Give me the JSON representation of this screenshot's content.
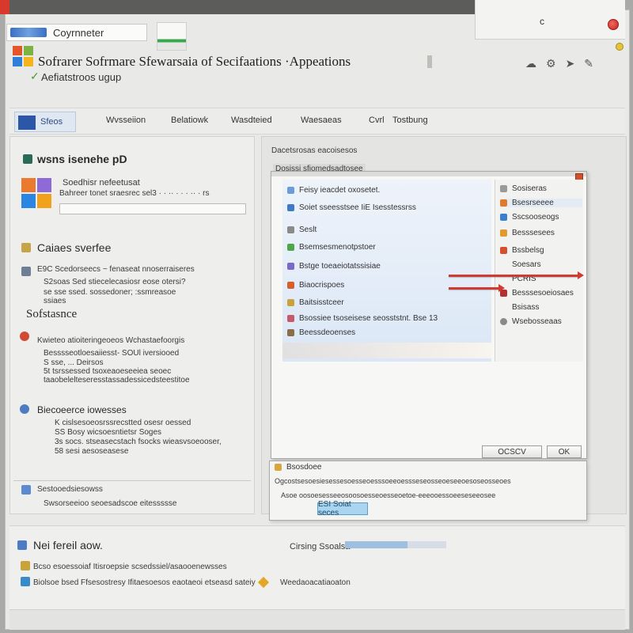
{
  "window": {
    "address_text": "Coyrnneter",
    "tab_letter": "c",
    "title_line1": "Sofrarer Sofrmare Sfewarsaia of Secifaations ·Appeations",
    "title_line2": "Aefiatstroos ugup"
  },
  "toolbar": {
    "items": [
      "Sfeos",
      "Wvsseiion",
      "Belatiowk",
      "Wasdteied",
      "Waesaeas",
      "Cvrl",
      "Tostbung"
    ]
  },
  "left_panel": {
    "heading1": "wsns isenehe pD",
    "line1": "Soedhisr nefeetusat",
    "line2": "Bahreer tonet sraesrec sel3  · · ·· ·  · · ·· ·  rs",
    "heading2": "Caiaes sverfee",
    "para1": [
      "E9C Scedorseecs ~ fenaseat nnoserraiseres",
      "S2soas Sed stiecelecasiosr eose otersi?",
      "se  sse   ssed. sossedoner; :ssmreasoe",
      "ssiaes"
    ],
    "heading3": "Sofstasnce",
    "para2": [
      "Kwieteo atioiteringeoeos Wchastaefoorgis",
      "Besssseotloesaiiesst- SOUl iversiooed",
      "S  sse,  ... Deirsos",
      "5t tsrssessed tsoxeaoeseeiea  seoec",
      "taaobelelteseresstassadessicedsteestitoe"
    ],
    "heading4": "Biecoeerce iowesses",
    "para3": [
      "K  cislsesoeosrssrecstted osesr oessed",
      "SS  Bosy wicsoesntietsr  Soges",
      "3s    socs. stseasecstach fsocks  wieasvsoeooser,",
      "58 sesi aesoseasese"
    ],
    "footer_h": "Sestooedsiesowss",
    "footer_t": "Swsorseeioo seoesadscoe eitessssse"
  },
  "right_panel": {
    "header1": "Dacetsrosas eacoisesos",
    "header2": "Dosissi sfiomedsadtosee"
  },
  "dialog": {
    "list_items": [
      "Feisy ieacdet oxosetet.",
      "Soiet  sseesstsee IiE  Isesstessrss",
      "Seslt",
      "Bsemsesmenotpstoer",
      "Bstge toeaeiotatssisiae",
      "Biaocrispoes",
      "Baitsisstceer",
      "Bsossiee tsoseisese seosststnt.  Bse 13",
      "Beessdeoenses"
    ],
    "side_items": [
      "Sosiseras",
      "Bsesrseeee",
      "Sscsooseogs",
      "Besssesees",
      "Bssbelsg",
      "Soesars",
      "PCRIS",
      "Besssesoeiosaes",
      "Bsisass",
      "Wsebosseaas"
    ],
    "buttons": [
      "OCSCV",
      "OK"
    ]
  },
  "bottom_dialog": {
    "title": "Bsosdoee",
    "line1": "Ogcostsesoesiesessesoesseoesssoeeoessseseosseoeseeoesoseosseoes",
    "line2": "Asoe  oosoesesseeosoosoesseoesseoetoe-eeeooessoeeseseeosee",
    "button": "ESI Soiat seces"
  },
  "footer": {
    "heading": "Nei fereil aow.",
    "line1": "Bcso esoessoiaf Itisroepsie scsedssiel/asaooenewsses",
    "line2": "Biolsoe bsed Ffsesostresy Ifitaesoesos eaotaeoi etseasd sateiy",
    "progress_label": "Cirsing Ssoalsa",
    "progress_fraction": 0.62,
    "right_label": "Weedaoacatiaoaton"
  },
  "colors": {
    "accent_blue": "#2c57a6",
    "close_red": "#d9382c",
    "arrow_red": "#d23a31",
    "highlight_blue": "#a9d5f1"
  },
  "icons": [
    "windows-logo-icon",
    "gear-icon",
    "cloud-icon",
    "share-icon",
    "pen-icon"
  ]
}
